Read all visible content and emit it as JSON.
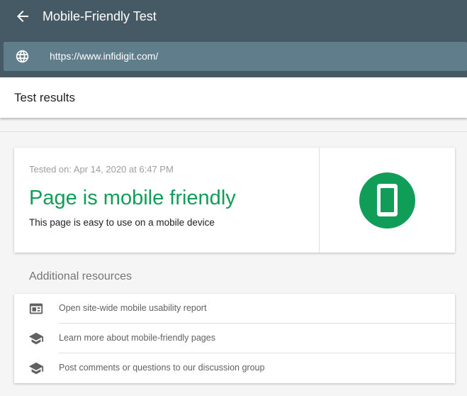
{
  "header": {
    "title": "Mobile-Friendly Test",
    "back_icon": "arrow-left-icon",
    "url": "https://www.infidigit.com/",
    "url_icon": "globe-icon"
  },
  "results": {
    "title": "Test results"
  },
  "result_card": {
    "tested_on": "Tested on: Apr 14, 2020 at 6:47 PM",
    "verdict": "Page is mobile friendly",
    "subtext": "This page is easy to use on a mobile device",
    "badge_icon": "mobile-phone-icon",
    "accent_color": "#0f9d58"
  },
  "resources": {
    "heading": "Additional resources",
    "items": [
      {
        "label": "Open site-wide mobile usability report",
        "icon": "report-window-icon"
      },
      {
        "label": "Learn more about mobile-friendly pages",
        "icon": "graduation-cap-icon"
      },
      {
        "label": "Post comments or questions to our discussion group",
        "icon": "graduation-cap-icon"
      }
    ]
  },
  "colors": {
    "header_bg": "#455a64",
    "urlbar_bg": "#607d8b",
    "success": "#0f9d58"
  }
}
